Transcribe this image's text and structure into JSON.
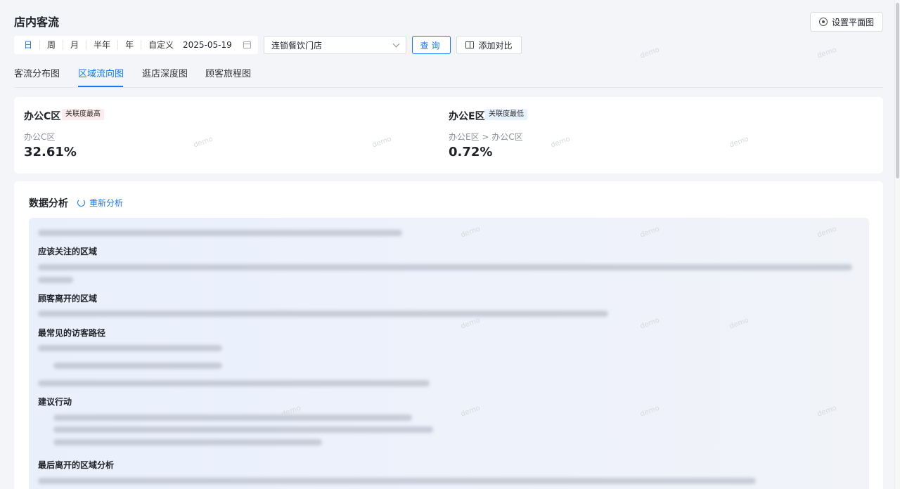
{
  "header": {
    "title": "店内客流",
    "plan_button": "设置平面图"
  },
  "filters": {
    "periods": [
      {
        "label": "日",
        "active": true
      },
      {
        "label": "周",
        "active": false
      },
      {
        "label": "月",
        "active": false
      },
      {
        "label": "半年",
        "active": false
      },
      {
        "label": "年",
        "active": false
      },
      {
        "label": "自定义",
        "active": false
      }
    ],
    "date": "2025-05-19",
    "store": "连锁餐饮门店",
    "query_button": "查询",
    "compare_button": "添加对比"
  },
  "tabs": [
    {
      "label": "客流分布图",
      "active": false
    },
    {
      "label": "区域流向图",
      "active": true
    },
    {
      "label": "逛店深度图",
      "active": false
    },
    {
      "label": "顾客旅程图",
      "active": false
    }
  ],
  "stats": {
    "highest": {
      "zone": "办公C区",
      "badge": "关联度最高",
      "path": "办公C区",
      "percent": "32.61%"
    },
    "lowest": {
      "zone": "办公E区",
      "badge": "关联度最低",
      "path": "办公E区 > 办公C区",
      "percent": "0.72%"
    }
  },
  "analysis": {
    "title": "数据分析",
    "reanalyze": "重新分析",
    "headings": [
      "应该关注的区域",
      "顾客离开的区域",
      "最常见的访客路径",
      "建议行动",
      "最后离开的区域分析"
    ]
  },
  "watermark": "demo",
  "colors": {
    "accent": "#1677ff",
    "background": "#f3f5f8"
  }
}
